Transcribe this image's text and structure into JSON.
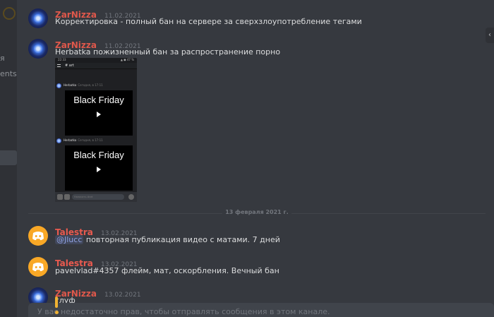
{
  "sidebar": {
    "items": [
      {
        "label": "я"
      },
      {
        "label": "ents"
      }
    ]
  },
  "messages": [
    {
      "author": "ZarNizza",
      "time": "11.02.2021",
      "text": "Корректировка - полный бан на сервере за сверхзлоупотребление тегами",
      "avatar": "zarnizza-avatar"
    },
    {
      "author": "ZarNizza",
      "time": "11.02.2021",
      "text": "Herbatka пожизненный бан за распространение порно",
      "avatar": "zarnizza-avatar"
    },
    {
      "author": "Talestra",
      "time": "13.02.2021",
      "mention": "@Jlucc",
      "text": " повторная публикация видео с матами. 7 дней",
      "avatar": "discord-logo-avatar"
    },
    {
      "author": "Talestra",
      "time": "13.02.2021",
      "text": "pavelvlad#4357  флейм, мат, оскорбления. Вечный бан",
      "avatar": "discord-logo-avatar"
    },
    {
      "author": "ZarNizza",
      "time": "13.02.2021",
      "text": "глуф",
      "avatar": "zarnizza-avatar"
    }
  ],
  "attachment": {
    "status_time": "22:33",
    "status_right": "▲ ◼ 47 %",
    "channel": "# art",
    "posts": [
      {
        "author": "Herbatka",
        "time": "Сегодня, в 17:11",
        "video_title": "Black Friday"
      },
      {
        "author": "Herbatka",
        "time": "Сегодня, в 17:11",
        "video_title": "Black Friday"
      }
    ],
    "input_placeholder": "Написать #art"
  },
  "date_divider": "13 февраля 2021 г.",
  "composer": {
    "placeholder": "У вас недостаточно прав, чтобы отправлять сообщения в этом канале."
  },
  "colors": {
    "background": "#36393f",
    "username_red": "#e0584b",
    "talestra_avatar": "#f9a826",
    "alert": "#f0b232"
  }
}
